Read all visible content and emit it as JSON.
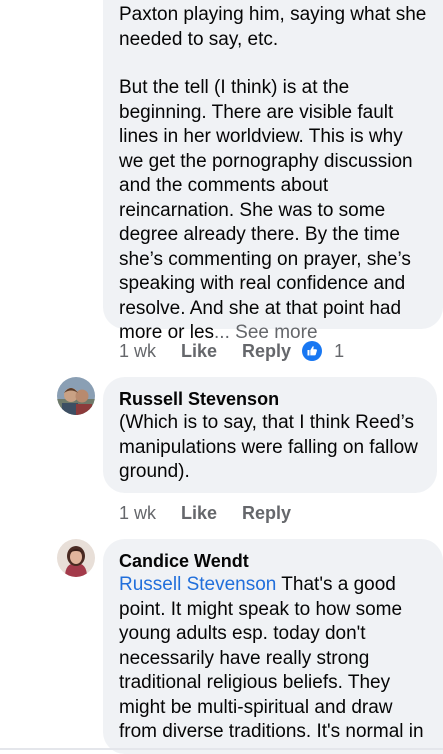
{
  "comment1": {
    "text_intro": "Paxton playing him, saying what she needed to say, etc.",
    "text_main": "But the tell (I think) is at the beginning. There are visible fault lines in her worldview. This is why we get the pornography discussion and the comments about reincarnation. She was to some degree already there. By the time she’s commenting on prayer, she’s speaking with real confidence and resolve. And she at that point had more or les",
    "see_more": "... See more",
    "time": "1 wk",
    "like_label": "Like",
    "reply_label": "Reply",
    "reaction_count": "1"
  },
  "comment2": {
    "author": "Russell Stevenson",
    "text": "(Which is to say, that I think Reed’s manipulations were falling on fallow ground).",
    "time": "1 wk",
    "like_label": "Like",
    "reply_label": "Reply"
  },
  "comment3": {
    "author": "Candice Wendt",
    "mention": "Russell Stevenson",
    "text": " That's a good point. It might speak to how some young adults esp. today don't necessarily have really strong traditional religious beliefs. They might be multi-spiritual and draw from diverse traditions. It's normal in"
  },
  "colors": {
    "bubble": "#f0f2f5",
    "link": "#216fdb",
    "meta": "#65676b",
    "like_blue": "#1877f2"
  },
  "icons": {
    "reaction": "like-thumb-icon",
    "avatar2": "avatar-russell",
    "avatar3": "avatar-candice"
  }
}
